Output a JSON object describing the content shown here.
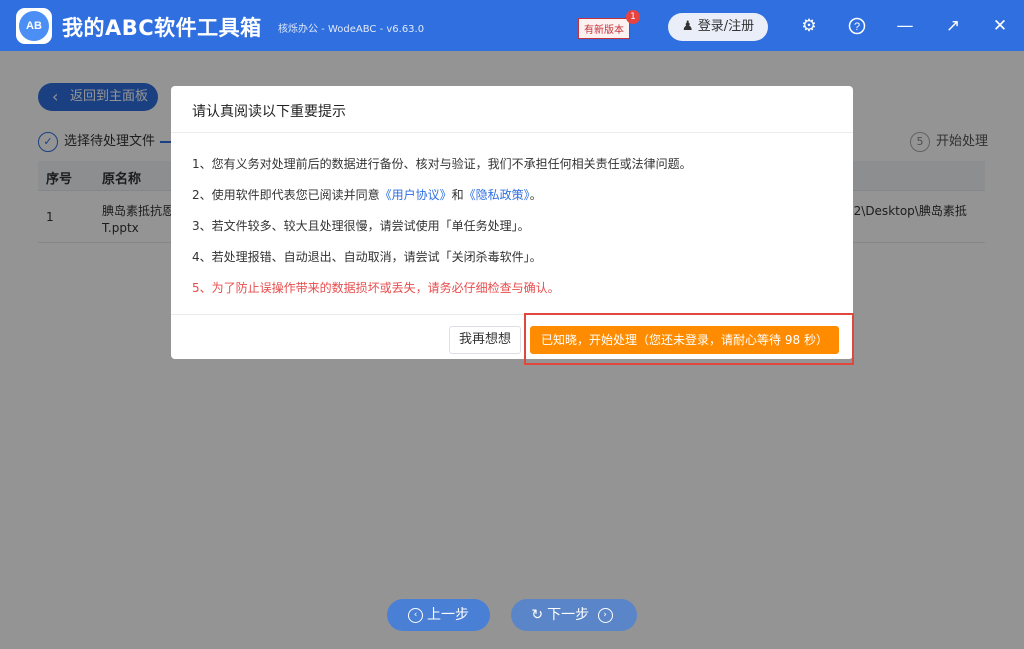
{
  "app": {
    "logo_text": "AB",
    "title": "我的ABC软件工具箱",
    "subtitle": "核烁办公 - WodeABC - v6.63.0",
    "new_version_label": "有新版本",
    "new_version_count": "1",
    "login_label": "登录/注册"
  },
  "background": {
    "back_label": "返回到主面板",
    "step1_label": "选择待处理文件",
    "step5_number": "5",
    "step5_label": "开始处理",
    "table": {
      "headers": [
        "序号",
        "原名称"
      ],
      "row_index": "1",
      "row_name_line1": "腆岛素抵抗恩",
      "row_name_line2": "T.pptx",
      "row_path": "82\\Desktop\\腆岛素抵"
    },
    "prev_label": "上一步",
    "next_label": "下一步"
  },
  "dialog": {
    "title": "请认真阅读以下重要提示",
    "line1": "1、您有义务对处理前后的数据进行备份、核对与验证，我们不承担任何相关责任或法律问题。",
    "line2_prefix": "2、使用软件即代表您已阅读并同意",
    "line2_link1": "《用户协议》",
    "line2_mid": "和",
    "line2_link2": "《隐私政策》",
    "line2_suffix": "。",
    "line3": "3、若文件较多、较大且处理很慢，请尝试使用「单任务处理」。",
    "line4": "4、若处理报错、自动退出、自动取消，请尝试「关闭杀毒软件」。",
    "line5": "5、为了防止误操作带来的数据损坏或丢失，请务必仔细检查与确认。",
    "think_label": "我再想想",
    "start_label": "已知晓，开始处理（您还未登录，请耐心等待 98 秒）"
  },
  "colors": {
    "titlebar": "#2f6fe0",
    "accent_orange": "#ff8c00",
    "warning_red": "#e84c4c",
    "link_blue": "#2f6fe0",
    "highlight_border": "#e0483e"
  }
}
